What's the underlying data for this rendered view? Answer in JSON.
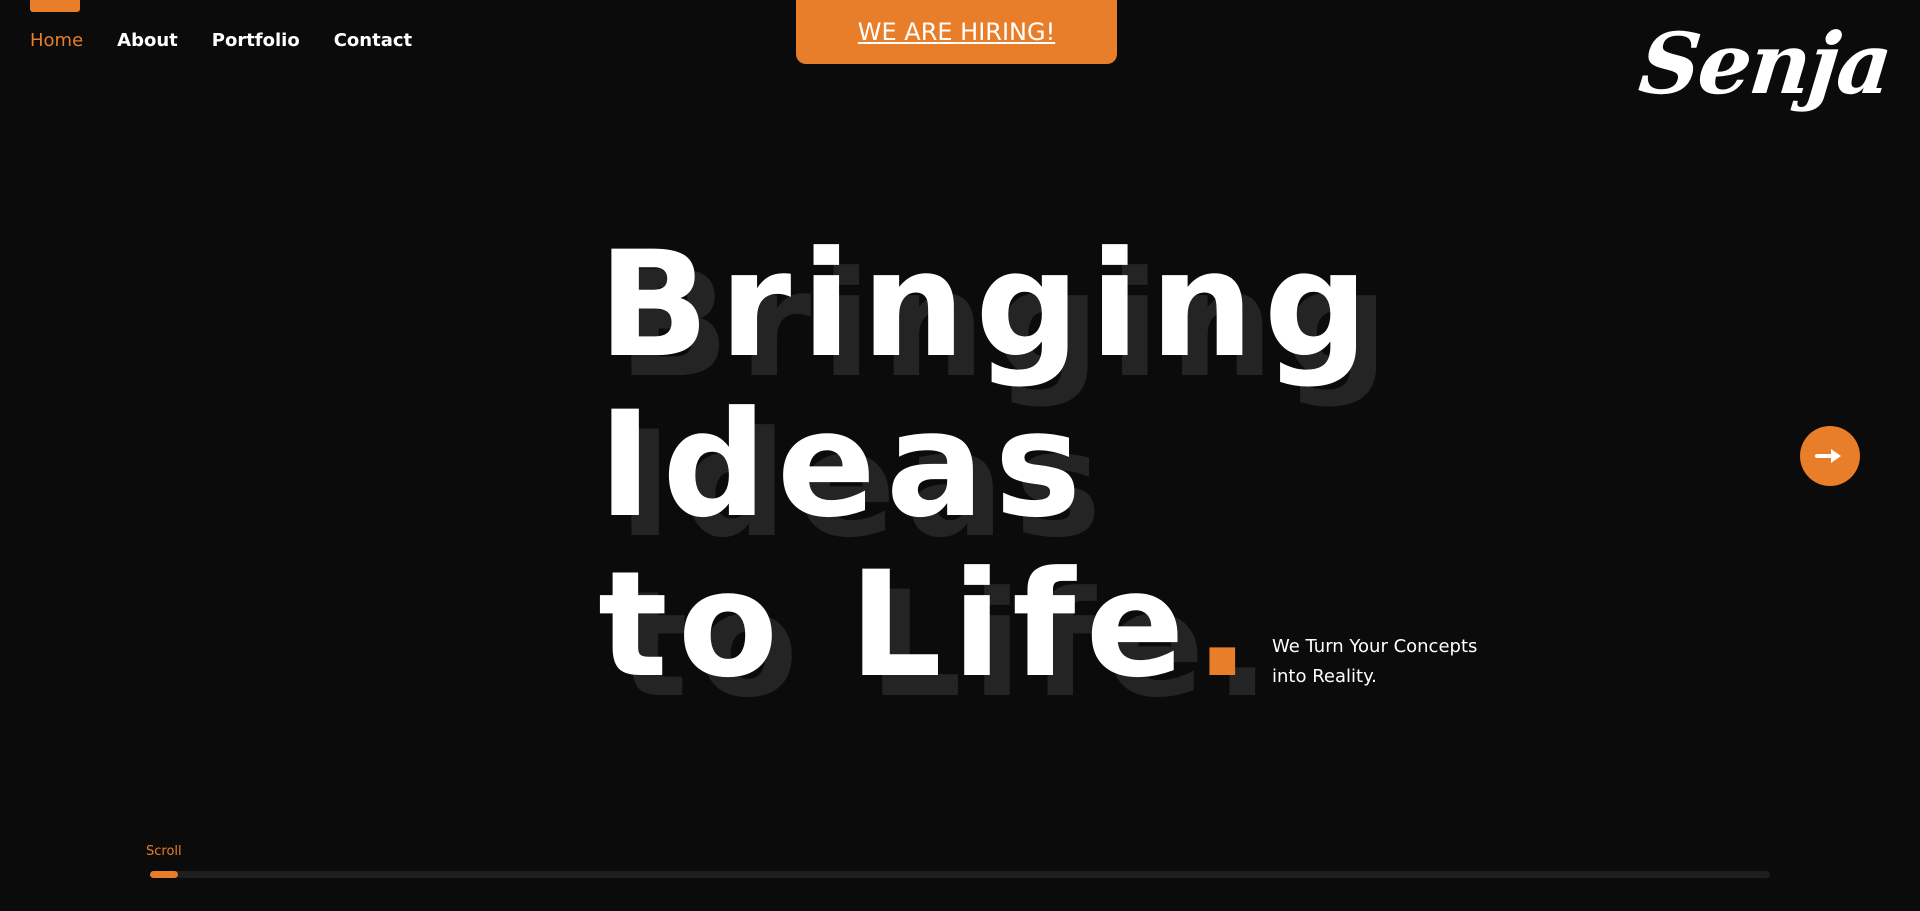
{
  "nav": {
    "items": [
      {
        "label": "Home",
        "active": true
      },
      {
        "label": "About",
        "active": false
      },
      {
        "label": "Portfolio",
        "active": false
      },
      {
        "label": "Contact",
        "active": false
      }
    ]
  },
  "banner": {
    "label": "WE ARE HIRING!"
  },
  "logo": {
    "text": "Senja"
  },
  "hero": {
    "line1": "Bringing",
    "line2": "Ideas",
    "line3": "to Life",
    "dot": ".",
    "subtext": "We Turn Your Concepts into Reality."
  },
  "next_button": {
    "icon": "arrow-right-icon"
  },
  "scroll": {
    "label": "Scroll",
    "progress": 0.017
  },
  "colors": {
    "accent": "#e87e2a",
    "background": "#0b0b0b",
    "shadow": "#242424"
  }
}
